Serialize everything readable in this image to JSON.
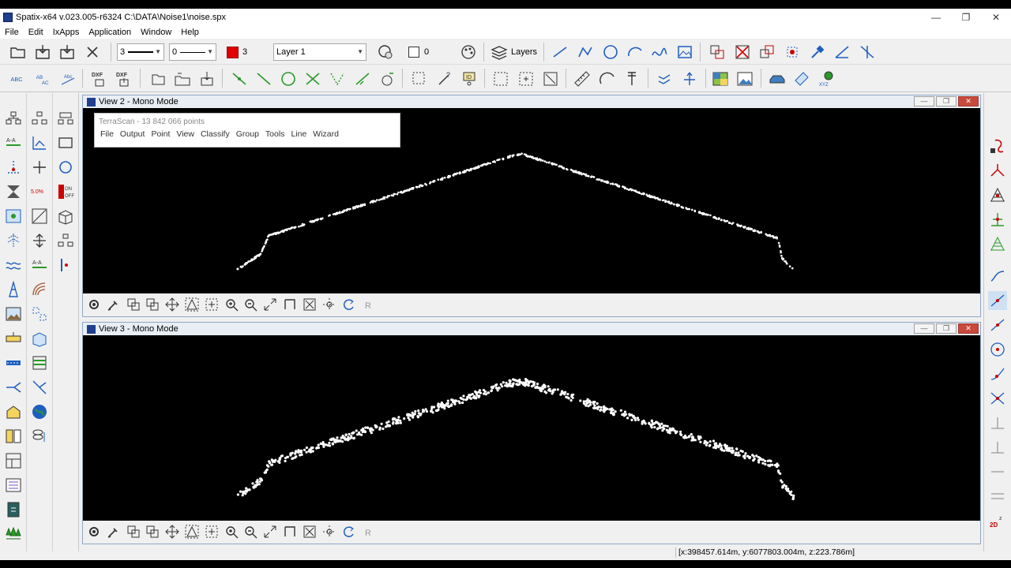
{
  "window": {
    "title": "Spatix-x64 v.023.005-r6324  C:\\DATA\\Noise1\\noise.spx",
    "controls": [
      "—",
      "❐",
      "✕"
    ]
  },
  "menu": [
    "File",
    "Edit",
    "IxApps",
    "Application",
    "Window",
    "Help"
  ],
  "toolbar": {
    "line_weight_value": "3",
    "line_style_value": "0",
    "color_index": "3",
    "layer_value": "Layer 1",
    "fill_value": "0",
    "layers_label": "Layers",
    "accent_color": "#e00000"
  },
  "views": [
    {
      "title": "View 2 - Mono Mode",
      "controls": [
        "—",
        "❐",
        "✕"
      ]
    },
    {
      "title": "View 3 - Mono Mode",
      "controls": [
        "—",
        "❐",
        "✕"
      ]
    }
  ],
  "terrascan": {
    "title": "TerraScan - 13 842 066 points",
    "menu": [
      "File",
      "Output",
      "Point",
      "View",
      "Classify",
      "Group",
      "Tools",
      "Line",
      "Wizard"
    ]
  },
  "status": {
    "coordinates": "[x:398457.614m, y:6077803.004m, z:223.786m]"
  }
}
